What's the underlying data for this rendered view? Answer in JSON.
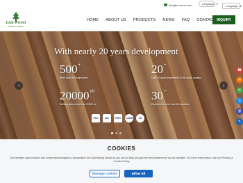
{
  "topbar": {
    "email": "info@er-wood.com",
    "language_label": "Language",
    "language_select": "Language"
  },
  "header": {
    "logo_text": "E&R WOOD",
    "logo_sub": "EXPERT IN WOOD",
    "nav": [
      "HOME",
      "ABOUT US",
      "PRODUCTS",
      "NEWS",
      "FAQ",
      "CONTACT US"
    ],
    "inquiry_label": "INQUIRY"
  },
  "hero": {
    "headline": "With nearly 20 years development",
    "stats": [
      {
        "num": "500",
        "plus": "+",
        "desc": "More than 500 employees"
      },
      {
        "num": "20",
        "plus": "+",
        "desc": "Over 20 years experience in the wood industry"
      },
      {
        "num": "20000",
        "plus": "m²",
        "desc": "Building area more than 20000 m²"
      },
      {
        "num": "30",
        "plus": "+",
        "desc": "Exported to more than 30 countries"
      }
    ],
    "certs": [
      "FSC",
      "ISO",
      "PEFC",
      "CARB",
      "CE"
    ],
    "prev_icon": "chevron-left-icon",
    "next_icon": "chevron-right-icon"
  },
  "floating": [
    "phone-icon",
    "chat-icon",
    "whatsapp-icon",
    "skype-icon",
    "email-icon",
    "inquiry-icon"
  ],
  "cookie": {
    "title": "COOKIES",
    "text": "Our website uses cookies and similar technologies to personalize the advertising shown to you and to help you get the best experience on our website. For more information, see our Privacy & Cookie Policy",
    "manage_label": "Manage cookies",
    "allow_label": "allow all"
  },
  "colors": {
    "brand_green": "#1b5e20",
    "cookie_blue": "#1565c0"
  }
}
